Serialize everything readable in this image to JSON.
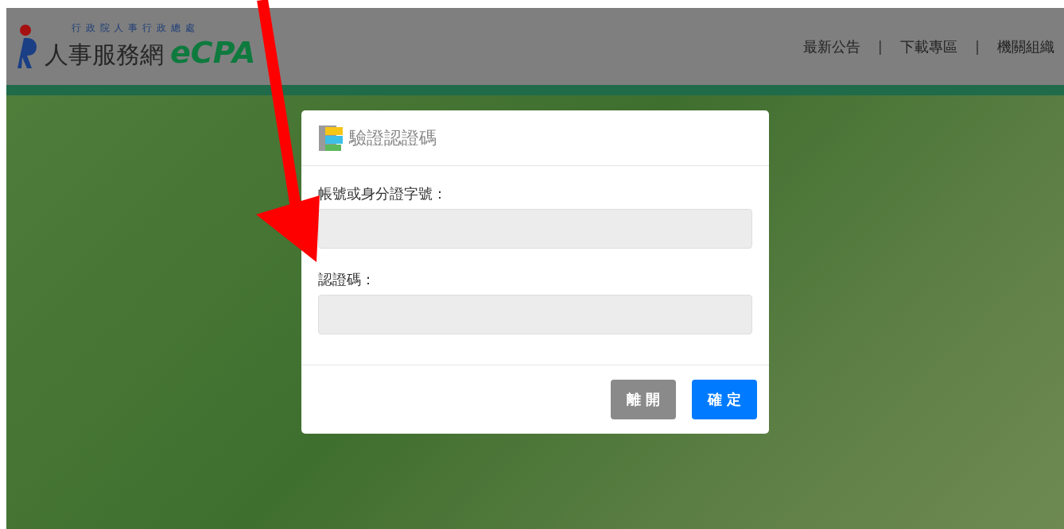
{
  "header": {
    "logo_subtitle": "行 政 院 人 事 行 政 總 處",
    "logo_title": "人事服務網",
    "logo_brand": "eCPA",
    "nav": [
      {
        "label": "最新公告"
      },
      {
        "label": "下載專區"
      },
      {
        "label": "機關組織"
      }
    ],
    "separator": "|"
  },
  "dialog": {
    "title": "驗證認證碼",
    "fields": [
      {
        "label": "帳號或身分證字號："
      },
      {
        "label": "認證碼："
      }
    ],
    "buttons": [
      {
        "label": "離 開",
        "kind": "secondary"
      },
      {
        "label": "確 定",
        "kind": "primary"
      }
    ]
  }
}
